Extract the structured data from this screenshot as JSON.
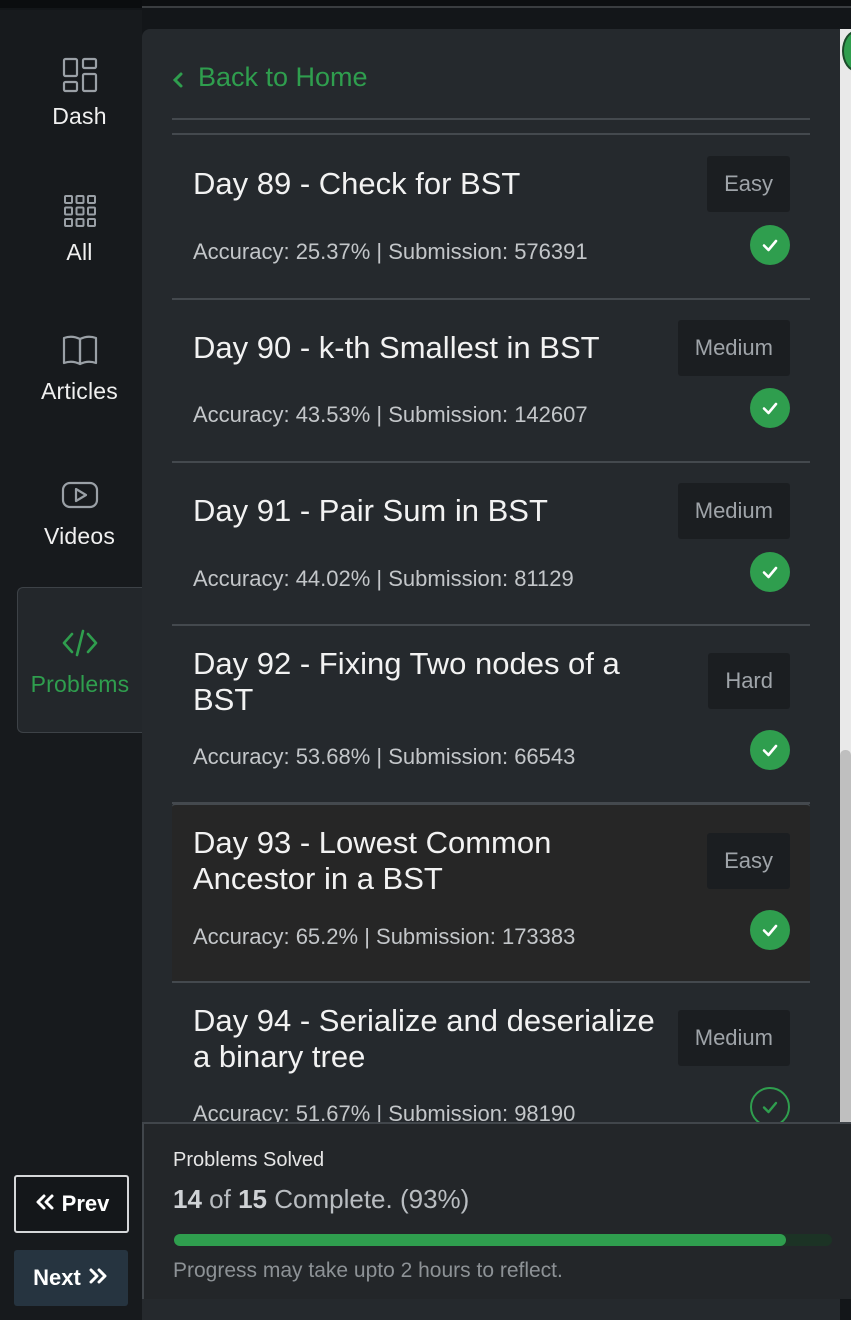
{
  "sidebar": {
    "items": [
      {
        "label": "Dash",
        "icon": "dashboard-icon"
      },
      {
        "label": "All",
        "icon": "grid-icon"
      },
      {
        "label": "Articles",
        "icon": "book-icon"
      },
      {
        "label": "Videos",
        "icon": "video-icon"
      },
      {
        "label": "Problems",
        "icon": "code-icon",
        "active": true
      }
    ],
    "prev_label": "Prev",
    "next_label": "Next"
  },
  "main": {
    "back_label": "Back to Home",
    "problems": [
      {
        "title": "Day 89 - Check for BST",
        "meta": "Accuracy: 25.37% | Submission: 576391",
        "difficulty": "Easy",
        "solved": true
      },
      {
        "title": "Day 90 - k-th Smallest in BST",
        "meta": "Accuracy: 43.53% | Submission: 142607",
        "difficulty": "Medium",
        "solved": true
      },
      {
        "title": "Day 91 - Pair Sum in BST",
        "meta": "Accuracy: 44.02% | Submission: 81129",
        "difficulty": "Medium",
        "solved": true
      },
      {
        "title": "Day 92 - Fixing Two nodes of a BST",
        "meta": "Accuracy: 53.68% | Submission: 66543",
        "difficulty": "Hard",
        "solved": true
      },
      {
        "title": "Day 93 - Lowest Common Ancestor in a BST",
        "meta": "Accuracy: 65.2% | Submission: 173383",
        "difficulty": "Easy",
        "solved": true
      },
      {
        "title": "Day 94 - Serialize and deserialize a binary tree",
        "meta": "Accuracy: 51.67% | Submission: 98190",
        "difficulty": "Medium",
        "solved": false
      }
    ]
  },
  "footer": {
    "title": "Problems Solved",
    "solved": "14",
    "of_label": "of",
    "total": "15",
    "complete_label": "Complete. (93%)",
    "progress_fraction": 0.93,
    "note": "Progress may take upto 2 hours to reflect."
  },
  "colors": {
    "accent": "#2f9e4e",
    "panel": "#25292d",
    "rail": "#171a1d"
  }
}
